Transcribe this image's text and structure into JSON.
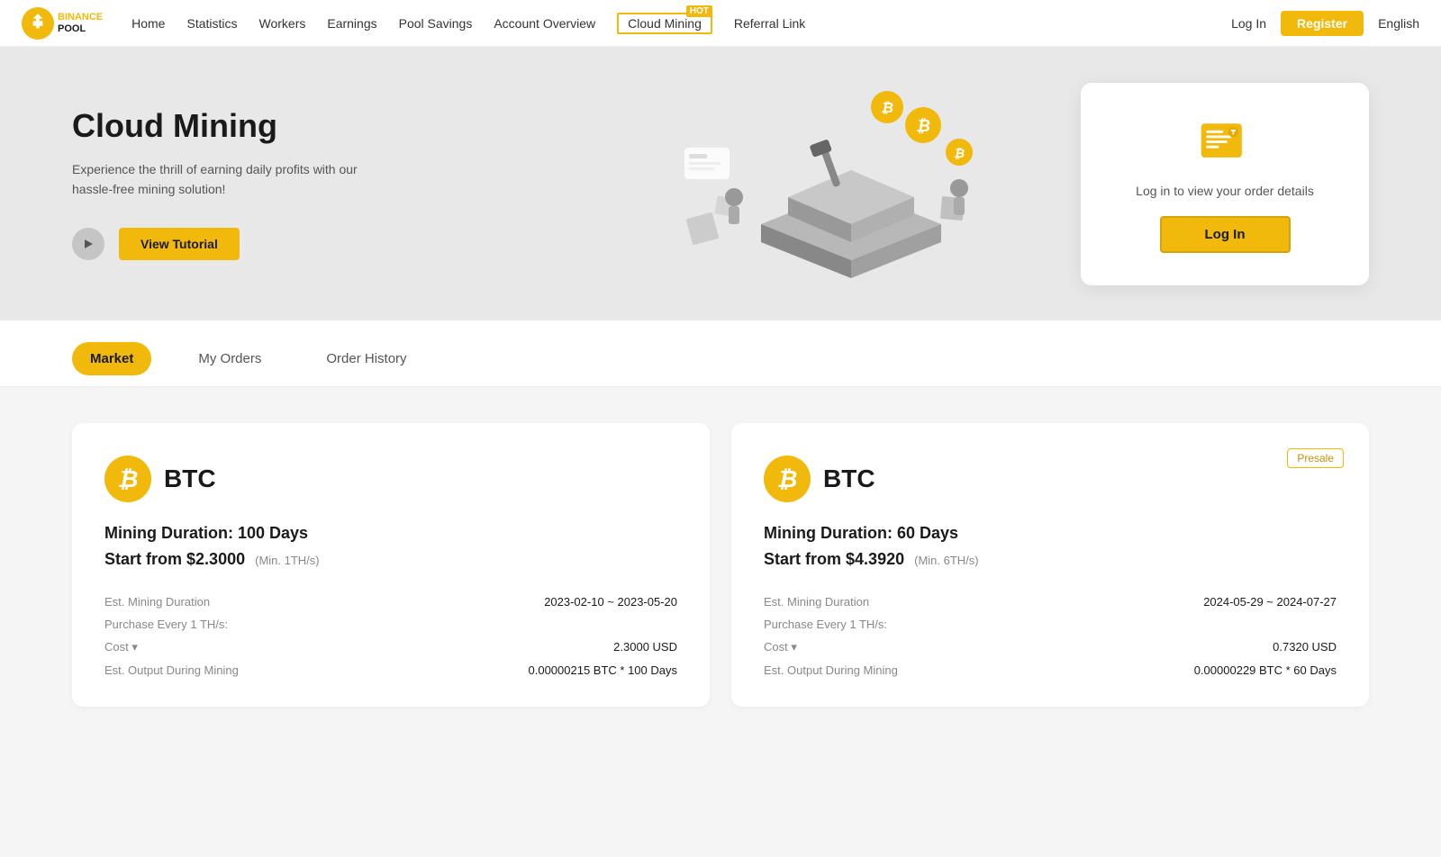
{
  "brand": {
    "name": "BINANCE POOL",
    "logo_text": "BINANCE\nPOOL"
  },
  "nav": {
    "links": [
      {
        "id": "home",
        "label": "Home"
      },
      {
        "id": "statistics",
        "label": "Statistics"
      },
      {
        "id": "workers",
        "label": "Workers"
      },
      {
        "id": "earnings",
        "label": "Earnings"
      },
      {
        "id": "pool-savings",
        "label": "Pool Savings"
      },
      {
        "id": "account-overview",
        "label": "Account Overview"
      },
      {
        "id": "cloud-mining",
        "label": "Cloud Mining",
        "hot": true
      },
      {
        "id": "referral-link",
        "label": "Referral Link"
      }
    ],
    "login": "Log In",
    "register": "Register",
    "language": "English"
  },
  "hero": {
    "title": "Cloud Mining",
    "subtitle": "Experience the thrill of earning daily profits with our hassle-free mining solution!",
    "view_tutorial": "View Tutorial",
    "card": {
      "desc": "Log in to view your order details",
      "login_btn": "Log In"
    }
  },
  "tabs": [
    {
      "id": "market",
      "label": "Market",
      "active": true
    },
    {
      "id": "my-orders",
      "label": "My Orders",
      "active": false
    },
    {
      "id": "order-history",
      "label": "Order History",
      "active": false
    }
  ],
  "cards": [
    {
      "coin": "BTC",
      "presale": false,
      "mining_duration_label": "Mining Duration:",
      "mining_duration_value": "100 Days",
      "start_from_label": "Start from",
      "start_from_price": "$2.3000",
      "min_label": "(Min. 1TH/s)",
      "details": [
        {
          "label": "Est. Mining Duration",
          "value": "2023-02-10 ~ 2023-05-20"
        },
        {
          "label": "Purchase Every 1 TH/s:",
          "value": ""
        },
        {
          "label": "Cost ▾",
          "value": "2.3000 USD"
        },
        {
          "label": "Est. Output During Mining",
          "value": "0.00000215 BTC * 100 Days"
        }
      ]
    },
    {
      "coin": "BTC",
      "presale": true,
      "presale_label": "Presale",
      "mining_duration_label": "Mining Duration:",
      "mining_duration_value": "60 Days",
      "start_from_label": "Start from",
      "start_from_price": "$4.3920",
      "min_label": "(Min. 6TH/s)",
      "details": [
        {
          "label": "Est. Mining Duration",
          "value": "2024-05-29 ~ 2024-07-27"
        },
        {
          "label": "Purchase Every 1 TH/s:",
          "value": ""
        },
        {
          "label": "Cost ▾",
          "value": "0.7320 USD"
        },
        {
          "label": "Est. Output During Mining",
          "value": "0.00000229 BTC * 60 Days"
        }
      ]
    }
  ]
}
